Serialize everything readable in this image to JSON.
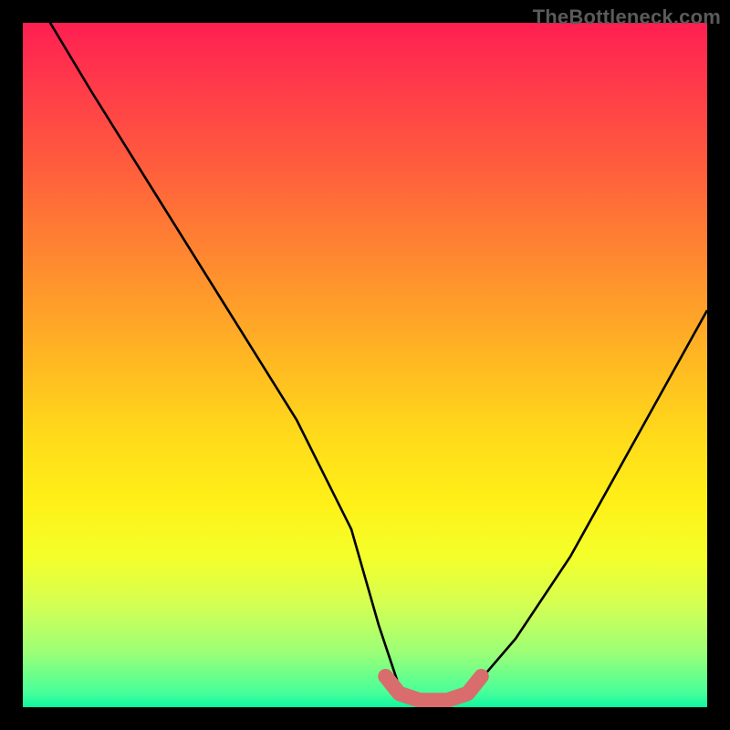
{
  "watermark": "TheBottleneck.com",
  "chart_data": {
    "type": "line",
    "title": "",
    "xlabel": "",
    "ylabel": "",
    "xlim": [
      0,
      100
    ],
    "ylim": [
      0,
      100
    ],
    "series": [
      {
        "name": "bottleneck-curve",
        "x": [
          0,
          4,
          10,
          20,
          30,
          40,
          48,
          52,
          55,
          58,
          62,
          66,
          72,
          80,
          90,
          100
        ],
        "values": [
          108,
          100,
          90,
          74,
          58,
          42,
          26,
          12,
          3,
          1,
          1,
          3,
          10,
          22,
          40,
          58
        ]
      },
      {
        "name": "optimal-range-marker",
        "x": [
          53,
          55,
          58,
          62,
          65,
          67
        ],
        "values": [
          4.5,
          2.0,
          1.0,
          1.0,
          2.0,
          4.5
        ]
      }
    ],
    "gradient_stops": [
      {
        "pos": 0,
        "color": "#ff1f52"
      },
      {
        "pos": 9,
        "color": "#ff3a4a"
      },
      {
        "pos": 20,
        "color": "#ff5a3e"
      },
      {
        "pos": 30,
        "color": "#ff7a34"
      },
      {
        "pos": 40,
        "color": "#ff9a2b"
      },
      {
        "pos": 50,
        "color": "#ffba22"
      },
      {
        "pos": 60,
        "color": "#ffd91a"
      },
      {
        "pos": 70,
        "color": "#fff018"
      },
      {
        "pos": 78,
        "color": "#f4ff2a"
      },
      {
        "pos": 85,
        "color": "#d4ff53"
      },
      {
        "pos": 92,
        "color": "#9cff77"
      },
      {
        "pos": 98,
        "color": "#45ff9a"
      },
      {
        "pos": 100,
        "color": "#0cf8a0"
      }
    ],
    "marker_color": "#d96c6c",
    "curve_color": "#000000"
  }
}
